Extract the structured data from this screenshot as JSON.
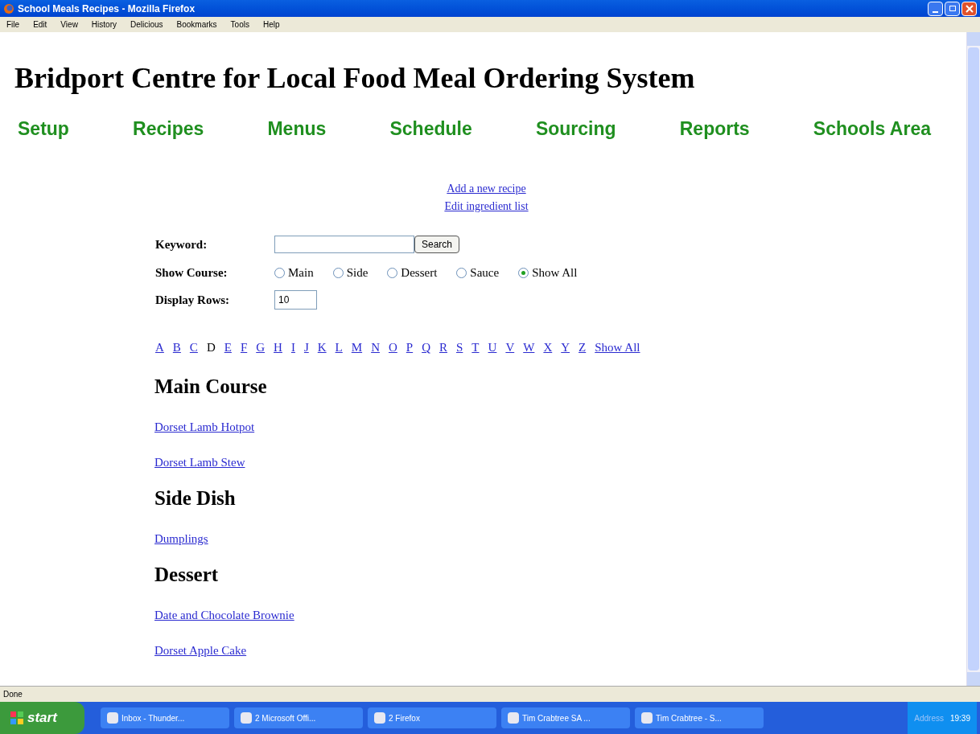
{
  "window": {
    "title": "School Meals Recipes - Mozilla Firefox"
  },
  "menu": [
    "File",
    "Edit",
    "View",
    "History",
    "Delicious",
    "Bookmarks",
    "Tools",
    "Help"
  ],
  "page": {
    "heading": "Bridport Centre for Local Food Meal Ordering System",
    "nav": [
      "Setup",
      "Recipes",
      "Menus",
      "Schedule",
      "Sourcing",
      "Reports",
      "Schools Area"
    ],
    "links": [
      "Add a new recipe",
      "Edit ingredient list"
    ],
    "form": {
      "keyword_label": "Keyword:",
      "search_button": "Search",
      "course_label": "Show Course:",
      "courses": [
        {
          "label": "Main",
          "selected": false
        },
        {
          "label": "Side",
          "selected": false
        },
        {
          "label": "Dessert",
          "selected": false
        },
        {
          "label": "Sauce",
          "selected": false
        },
        {
          "label": "Show All",
          "selected": true
        }
      ],
      "rows_label": "Display Rows:",
      "rows": {
        "value": "10"
      }
    },
    "letters": [
      {
        "label": "A",
        "selected": false
      },
      {
        "label": "B",
        "selected": false
      },
      {
        "label": "C",
        "selected": false
      },
      {
        "label": "D",
        "selected": true
      },
      {
        "label": "E",
        "selected": false
      },
      {
        "label": "F",
        "selected": false
      },
      {
        "label": "G",
        "selected": false
      },
      {
        "label": "H",
        "selected": false
      },
      {
        "label": "I",
        "selected": false
      },
      {
        "label": "J",
        "selected": false
      },
      {
        "label": "K",
        "selected": false
      },
      {
        "label": "L",
        "selected": false
      },
      {
        "label": "M",
        "selected": false
      },
      {
        "label": "N",
        "selected": false
      },
      {
        "label": "O",
        "selected": false
      },
      {
        "label": "P",
        "selected": false
      },
      {
        "label": "Q",
        "selected": false
      },
      {
        "label": "R",
        "selected": false
      },
      {
        "label": "S",
        "selected": false
      },
      {
        "label": "T",
        "selected": false
      },
      {
        "label": "U",
        "selected": false
      },
      {
        "label": "V",
        "selected": false
      },
      {
        "label": "W",
        "selected": false
      },
      {
        "label": "X",
        "selected": false
      },
      {
        "label": "Y",
        "selected": false
      },
      {
        "label": "Z",
        "selected": false
      },
      {
        "label": "Show All",
        "selected": false
      }
    ],
    "sections": [
      {
        "title": "Main Course",
        "recipes": [
          "Dorset Lamb Hotpot",
          "Dorset Lamb Stew"
        ]
      },
      {
        "title": "Side Dish",
        "recipes": [
          "Dumplings"
        ]
      },
      {
        "title": "Dessert",
        "recipes": [
          "Date and Chocolate Brownie",
          "Dorset Apple Cake"
        ]
      }
    ]
  },
  "status_bar": {
    "text": "Done"
  },
  "taskbar": {
    "start": "start",
    "tasks": [
      "Inbox - Thunder...",
      "2 Microsoft Offi...",
      "2 Firefox",
      "Tim Crabtree SA ...",
      "Tim Crabtree - S..."
    ],
    "address": "Address",
    "time": "19:39"
  }
}
